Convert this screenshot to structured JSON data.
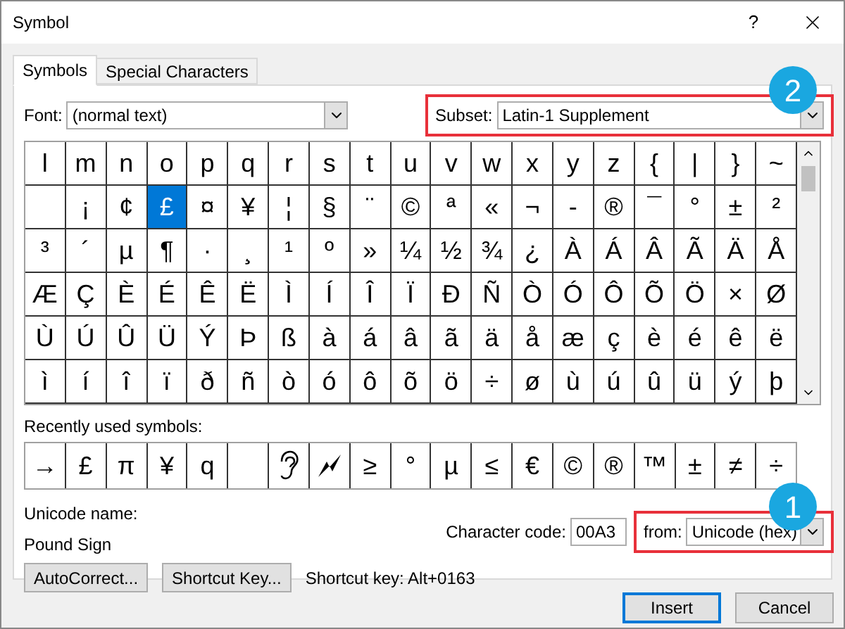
{
  "window": {
    "title": "Symbol",
    "help": "?"
  },
  "tabs": [
    {
      "label": "Symbols",
      "selected": true
    },
    {
      "label": "Special Characters",
      "selected": false
    }
  ],
  "font": {
    "label": "Font:",
    "value": "(normal text)"
  },
  "subset": {
    "label": "Subset:",
    "value": "Latin-1 Supplement",
    "badge": "2"
  },
  "grid": [
    [
      {
        "char": "l",
        "selected": false
      },
      {
        "char": "m",
        "selected": false
      },
      {
        "char": "n",
        "selected": false
      },
      {
        "char": "o",
        "selected": false
      },
      {
        "char": "p",
        "selected": false
      },
      {
        "char": "q",
        "selected": false
      },
      {
        "char": "r",
        "selected": false
      },
      {
        "char": "s",
        "selected": false
      },
      {
        "char": "t",
        "selected": false
      },
      {
        "char": "u",
        "selected": false
      },
      {
        "char": "v",
        "selected": false
      },
      {
        "char": "w",
        "selected": false
      },
      {
        "char": "x",
        "selected": false
      },
      {
        "char": "y",
        "selected": false
      },
      {
        "char": "z",
        "selected": false
      },
      {
        "char": "{",
        "selected": false
      },
      {
        "char": "|",
        "selected": false
      },
      {
        "char": "}",
        "selected": false
      },
      {
        "char": "~",
        "selected": false
      }
    ],
    [
      {
        "selected": false
      },
      {
        "char": "¡",
        "selected": false
      },
      {
        "char": "¢",
        "selected": false
      },
      {
        "char": "£",
        "selected": true
      },
      {
        "char": "¤",
        "selected": false
      },
      {
        "char": "¥",
        "selected": false
      },
      {
        "char": "¦",
        "selected": false
      },
      {
        "char": "§",
        "selected": false
      },
      {
        "char": "¨",
        "selected": false
      },
      {
        "char": "©",
        "selected": false
      },
      {
        "char": "ª",
        "selected": false
      },
      {
        "char": "«",
        "selected": false
      },
      {
        "char": "¬",
        "selected": false
      },
      {
        "char": "-",
        "selected": false
      },
      {
        "char": "®",
        "selected": false
      },
      {
        "char": "¯",
        "selected": false
      },
      {
        "char": "°",
        "selected": false
      },
      {
        "char": "±",
        "selected": false
      },
      {
        "char": "²",
        "selected": false
      }
    ],
    [
      {
        "char": "³",
        "selected": false
      },
      {
        "char": "´",
        "selected": false
      },
      {
        "char": "µ",
        "selected": false
      },
      {
        "char": "¶",
        "selected": false
      },
      {
        "char": "·",
        "selected": false
      },
      {
        "char": "¸",
        "selected": false
      },
      {
        "char": "¹",
        "selected": false
      },
      {
        "char": "º",
        "selected": false
      },
      {
        "char": "»",
        "selected": false
      },
      {
        "char": "¼",
        "selected": false
      },
      {
        "char": "½",
        "selected": false
      },
      {
        "char": "¾",
        "selected": false
      },
      {
        "char": "¿",
        "selected": false
      },
      {
        "char": "À",
        "selected": false
      },
      {
        "char": "Á",
        "selected": false
      },
      {
        "char": "Â",
        "selected": false
      },
      {
        "char": "Ã",
        "selected": false
      },
      {
        "char": "Ä",
        "selected": false
      },
      {
        "char": "Å",
        "selected": false
      }
    ],
    [
      {
        "char": "Æ",
        "selected": false
      },
      {
        "char": "Ç",
        "selected": false
      },
      {
        "char": "È",
        "selected": false
      },
      {
        "char": "É",
        "selected": false
      },
      {
        "char": "Ê",
        "selected": false
      },
      {
        "char": "Ë",
        "selected": false
      },
      {
        "char": "Ì",
        "selected": false
      },
      {
        "char": "Í",
        "selected": false
      },
      {
        "char": "Î",
        "selected": false
      },
      {
        "char": "Ï",
        "selected": false
      },
      {
        "char": "Ð",
        "selected": false
      },
      {
        "char": "Ñ",
        "selected": false
      },
      {
        "char": "Ò",
        "selected": false
      },
      {
        "char": "Ó",
        "selected": false
      },
      {
        "char": "Ô",
        "selected": false
      },
      {
        "char": "Õ",
        "selected": false
      },
      {
        "char": "Ö",
        "selected": false
      },
      {
        "char": "×",
        "selected": false
      },
      {
        "char": "Ø",
        "selected": false
      }
    ],
    [
      {
        "char": "Ù",
        "selected": false
      },
      {
        "char": "Ú",
        "selected": false
      },
      {
        "char": "Û",
        "selected": false
      },
      {
        "char": "Ü",
        "selected": false
      },
      {
        "char": "Ý",
        "selected": false
      },
      {
        "char": "Þ",
        "selected": false
      },
      {
        "char": "ß",
        "selected": false
      },
      {
        "char": "à",
        "selected": false
      },
      {
        "char": "á",
        "selected": false
      },
      {
        "char": "â",
        "selected": false
      },
      {
        "char": "ã",
        "selected": false
      },
      {
        "char": "ä",
        "selected": false
      },
      {
        "char": "å",
        "selected": false
      },
      {
        "char": "æ",
        "selected": false
      },
      {
        "char": "ç",
        "selected": false
      },
      {
        "char": "è",
        "selected": false
      },
      {
        "char": "é",
        "selected": false
      },
      {
        "char": "ê",
        "selected": false
      },
      {
        "char": "ë",
        "selected": false
      }
    ],
    [
      {
        "char": "ì",
        "selected": false
      },
      {
        "char": "í",
        "selected": false
      },
      {
        "char": "î",
        "selected": false
      },
      {
        "char": "ï",
        "selected": false
      },
      {
        "char": "ð",
        "selected": false
      },
      {
        "char": "ñ",
        "selected": false
      },
      {
        "char": "ò",
        "selected": false
      },
      {
        "char": "ó",
        "selected": false
      },
      {
        "char": "ô",
        "selected": false
      },
      {
        "char": "õ",
        "selected": false
      },
      {
        "char": "ö",
        "selected": false
      },
      {
        "char": "÷",
        "selected": false
      },
      {
        "char": "ø",
        "selected": false
      },
      {
        "char": "ù",
        "selected": false
      },
      {
        "char": "ú",
        "selected": false
      },
      {
        "char": "û",
        "selected": false
      },
      {
        "char": "ü",
        "selected": false
      },
      {
        "char": "ý",
        "selected": false
      },
      {
        "char": "þ",
        "selected": false
      }
    ]
  ],
  "recent_label": "Recently used symbols:",
  "recent": [
    {
      "kind": "char",
      "char": "→"
    },
    {
      "kind": "char",
      "char": "£"
    },
    {
      "kind": "char",
      "char": "π"
    },
    {
      "kind": "char",
      "char": "¥"
    },
    {
      "kind": "char",
      "char": "q"
    },
    {
      "kind": "blank"
    },
    {
      "kind": "ear"
    },
    {
      "kind": "bolt"
    },
    {
      "kind": "char",
      "char": "≥"
    },
    {
      "kind": "char",
      "char": "°"
    },
    {
      "kind": "char",
      "char": "µ"
    },
    {
      "kind": "char",
      "char": "≤"
    },
    {
      "kind": "char",
      "char": "€"
    },
    {
      "kind": "char",
      "char": "©"
    },
    {
      "kind": "char",
      "char": "®"
    },
    {
      "kind": "char",
      "char": "™"
    },
    {
      "kind": "char",
      "char": "±"
    },
    {
      "kind": "char",
      "char": "≠"
    },
    {
      "kind": "char",
      "char": "÷"
    }
  ],
  "unicode_name": {
    "label": "Unicode name:",
    "value": "Pound Sign"
  },
  "character_code": {
    "label": "Character code:",
    "value": "00A3"
  },
  "encoding": {
    "label": "from:",
    "value": "Unicode (hex)",
    "badge": "1"
  },
  "autocorrect_button": "AutoCorrect...",
  "shortcut_button": "Shortcut Key...",
  "shortcut_text": "Shortcut key: Alt+0163",
  "buttons": [
    {
      "label": "Insert",
      "default": true
    },
    {
      "label": "Cancel",
      "default": false
    }
  ]
}
